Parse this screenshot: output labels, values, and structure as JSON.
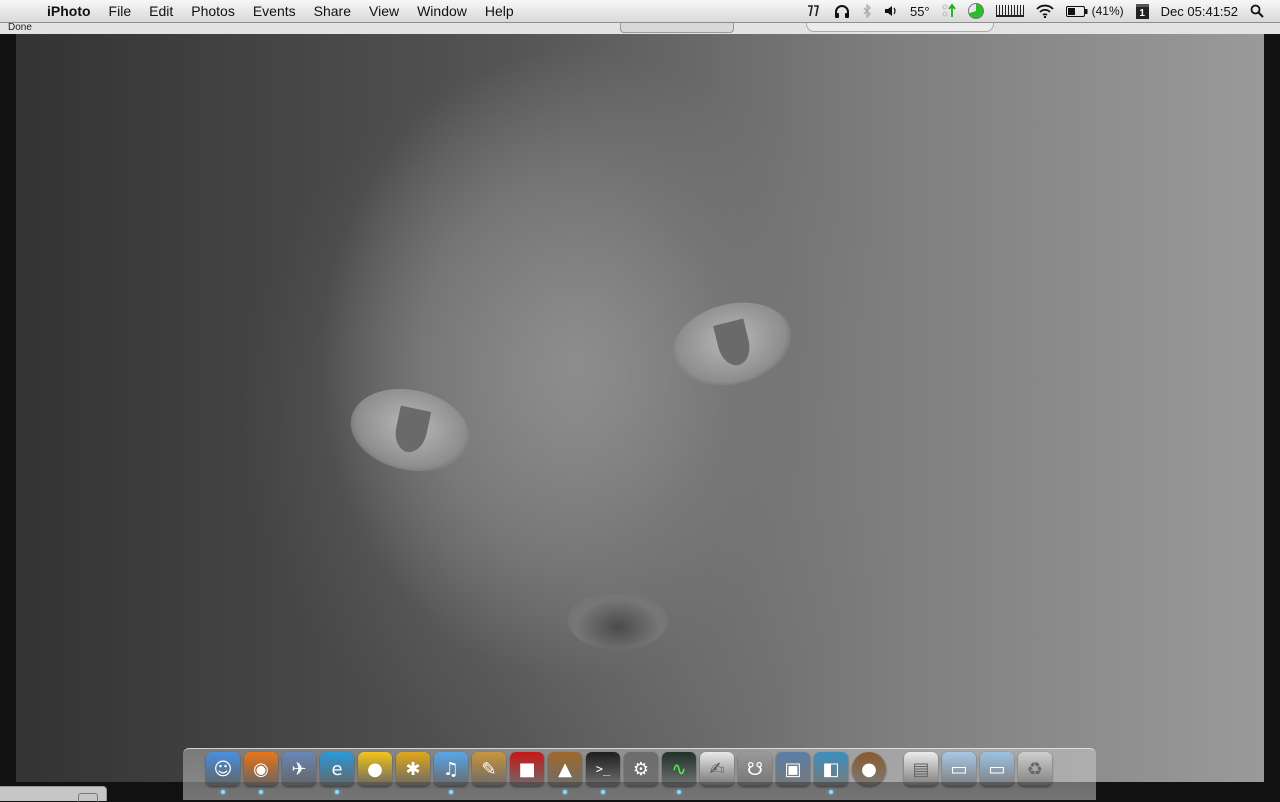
{
  "menubar": {
    "apple_glyph": "",
    "items": [
      "iPhoto",
      "File",
      "Edit",
      "Photos",
      "Events",
      "Share",
      "View",
      "Window",
      "Help"
    ],
    "status": {
      "weather_icon": "lightning-icon",
      "temperature": "55°",
      "battery_percent": "(41%)",
      "calendar_day": "1",
      "clock": "Dec 05:41:52"
    }
  },
  "subbar": {
    "status_text": "Done"
  },
  "photo": {
    "subject": "cat-photo"
  },
  "dock": {
    "apps": [
      {
        "name": "finder-icon",
        "glyph": "☺",
        "color": "#4a8fe0"
      },
      {
        "name": "firefox-icon",
        "glyph": "◉",
        "color": "#e8761b"
      },
      {
        "name": "mail-stamp-icon",
        "glyph": "✈",
        "color": "#6a88b8"
      },
      {
        "name": "internet-explorer-icon",
        "glyph": "e",
        "color": "#2a9ad8"
      },
      {
        "name": "adium-duck-icon",
        "glyph": "●",
        "color": "#f3c51a"
      },
      {
        "name": "dashcode-icon",
        "glyph": "✱",
        "color": "#e0a81c"
      },
      {
        "name": "itunes-icon",
        "glyph": "♫",
        "color": "#5aa6e8"
      },
      {
        "name": "script-editor-icon",
        "glyph": "✎",
        "color": "#c8963c"
      },
      {
        "name": "red-photo-booth-icon",
        "glyph": "■",
        "color": "#c81818"
      },
      {
        "name": "iphoto-icon",
        "glyph": "▲",
        "color": "#a0682a"
      },
      {
        "name": "terminal-icon",
        "glyph": ">_",
        "color": "#1e1e1e"
      },
      {
        "name": "system-preferences-icon",
        "glyph": "⚙",
        "color": "#6d6d6d"
      },
      {
        "name": "activity-monitor-icon",
        "glyph": "∿",
        "color": "#203228"
      },
      {
        "name": "textedit-icon",
        "glyph": "✍",
        "color": "#e9e9e9"
      },
      {
        "name": "utility-comb-icon",
        "glyph": "☋",
        "color": "#9a9a9a"
      },
      {
        "name": "image-viewer-icon",
        "glyph": "▣",
        "color": "#5b7fa8"
      },
      {
        "name": "preview-icon",
        "glyph": "◧",
        "color": "#3d8fbf"
      },
      {
        "name": "coconut-battery-icon",
        "glyph": "●",
        "color": "#8a5a2b"
      }
    ],
    "folders": [
      {
        "name": "document-stack-icon",
        "glyph": "▤",
        "color": "#ececec"
      },
      {
        "name": "documents-folder-icon",
        "glyph": "▭",
        "color": "#a7c8e6"
      },
      {
        "name": "downloads-folder-icon",
        "glyph": "▭",
        "color": "#9cc2e2"
      },
      {
        "name": "trash-icon",
        "glyph": "♻",
        "color": "#cfcfcf"
      }
    ]
  }
}
